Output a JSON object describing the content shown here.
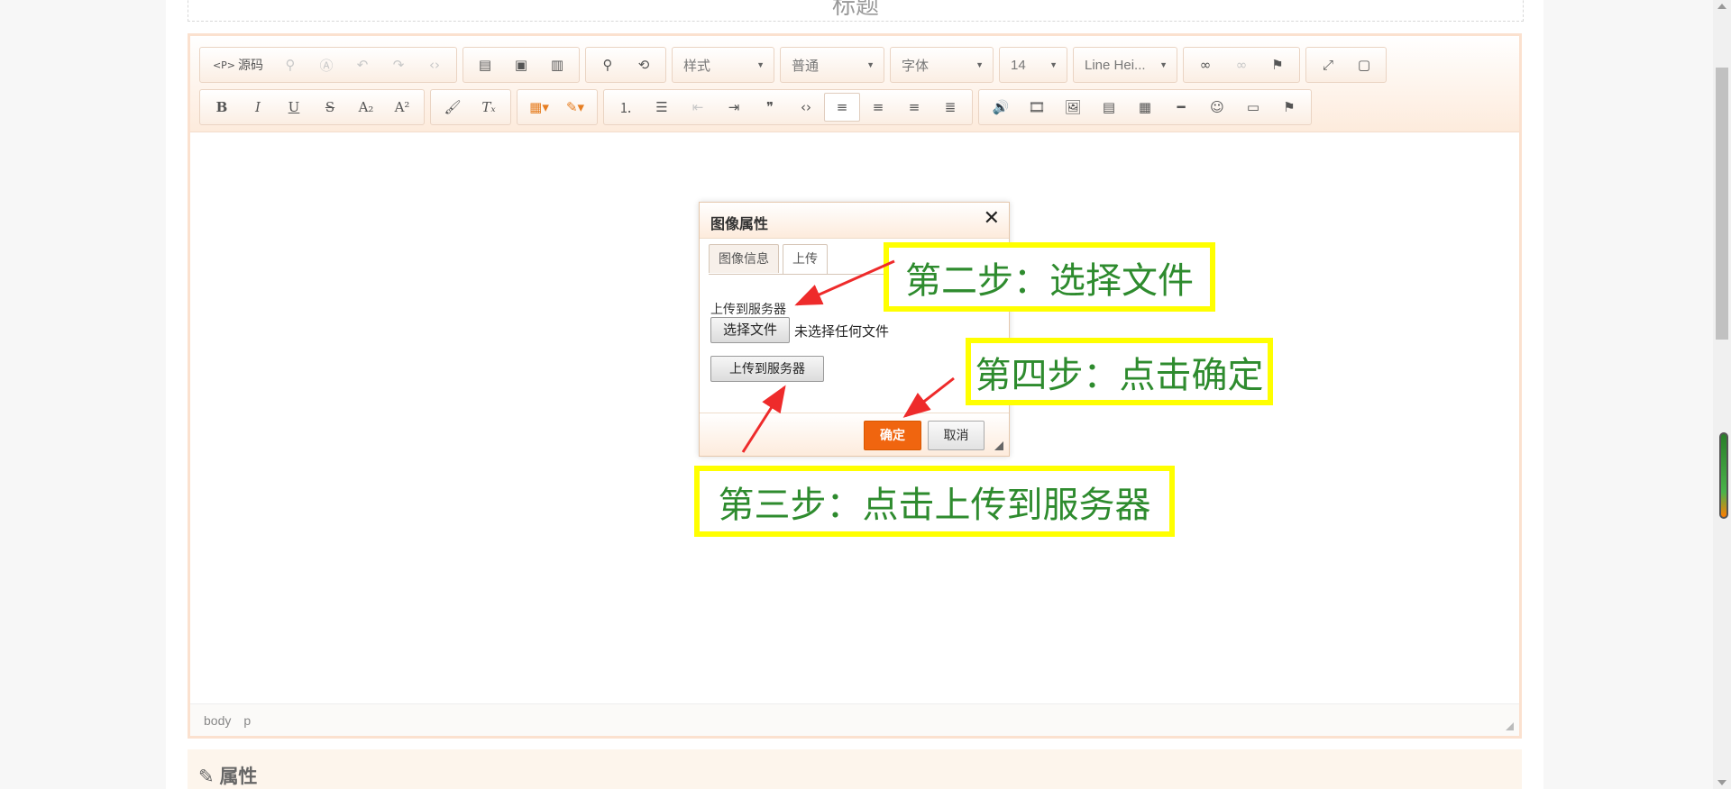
{
  "title_placeholder": "标题",
  "toolbar": {
    "source_label": "源码",
    "style_combo": "样式",
    "format_combo": "普通",
    "font_combo": "字体",
    "size_combo": "14",
    "lineheight_combo": "Line Hei..."
  },
  "statusbar": {
    "path": [
      "body",
      "p"
    ]
  },
  "properties_panel": {
    "title": "属性"
  },
  "dialog": {
    "title": "图像属性",
    "tabs": [
      "图像信息",
      "上传"
    ],
    "active_tab": "上传",
    "upload_label": "上传到服务器",
    "choose_file_button": "选择文件",
    "no_file_text": "未选择任何文件",
    "upload_button": "上传到服务器",
    "ok_button": "确定",
    "cancel_button": "取消"
  },
  "annotations": {
    "step2": "第二步：选择文件",
    "step3": "第三步：点击上传到服务器",
    "step4": "第四步：点击确定"
  },
  "colors": {
    "annotation_border": "#ffff00",
    "annotation_text": "#2e8b2e",
    "arrow": "#ee2b2b",
    "ok_button": "#f0650f"
  }
}
